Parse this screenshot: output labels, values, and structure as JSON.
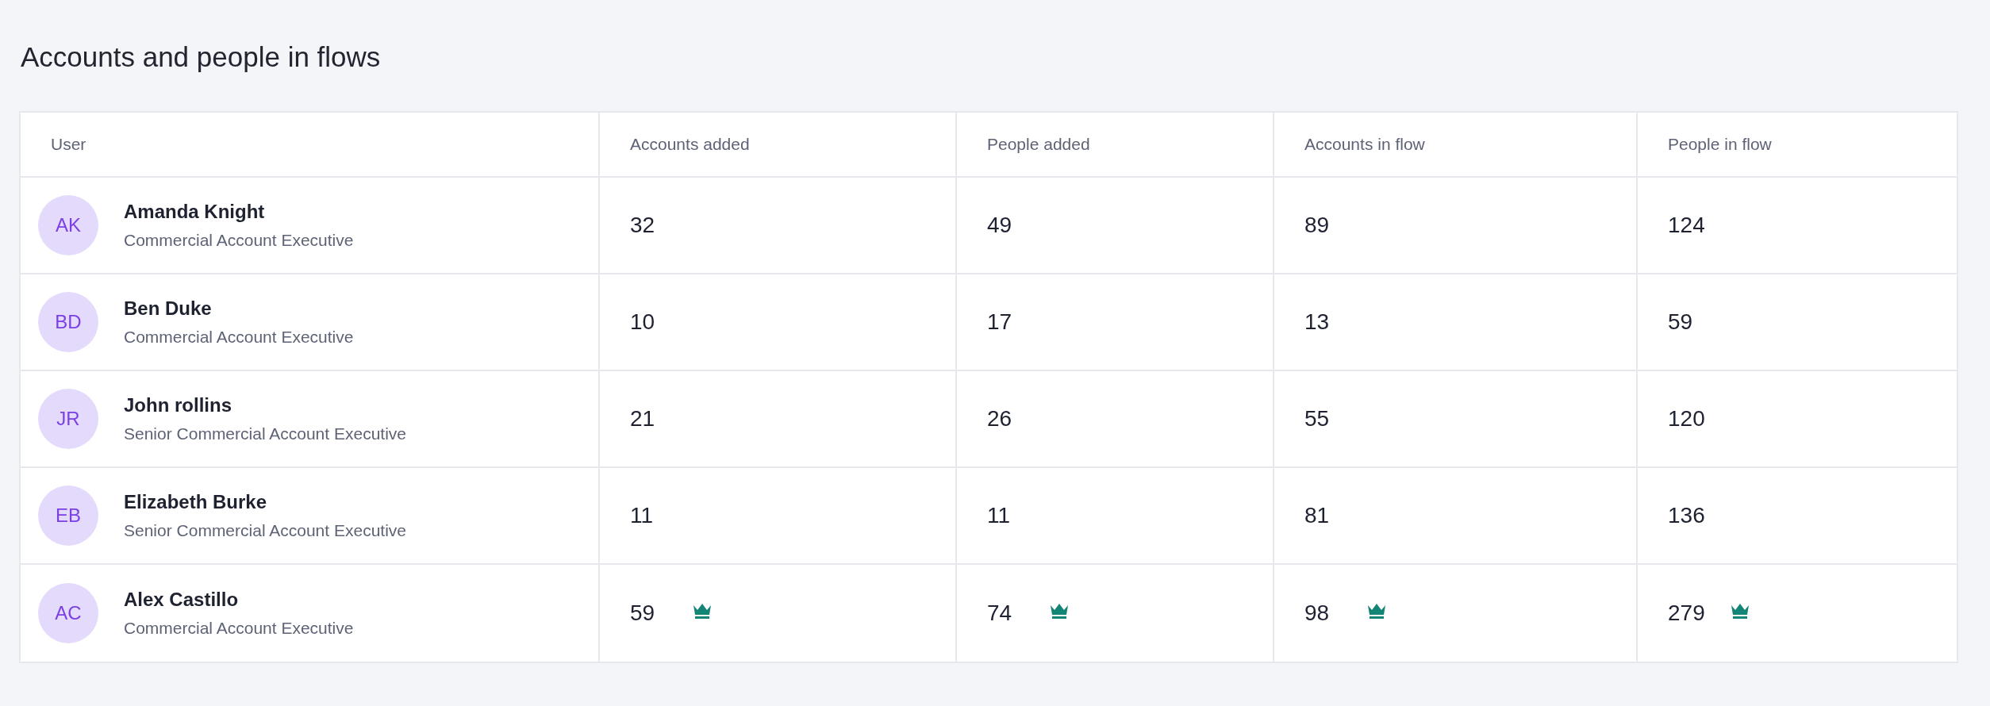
{
  "title": "Accounts and people in flows",
  "table": {
    "columns": [
      "User",
      "Accounts added",
      "People added",
      "Accounts in flow",
      "People in flow"
    ],
    "rows": [
      {
        "cells": [
          {
            "kind": "user",
            "initials": "AK",
            "name": "Amanda Knight",
            "role": "Commercial Account Executive"
          },
          {
            "kind": "metric",
            "value": "32",
            "top": false
          },
          {
            "kind": "metric",
            "value": "49",
            "top": false
          },
          {
            "kind": "metric",
            "value": "89",
            "top": false
          },
          {
            "kind": "metric",
            "value": "124",
            "top": false
          }
        ]
      },
      {
        "cells": [
          {
            "kind": "user",
            "initials": "BD",
            "name": "Ben Duke",
            "role": "Commercial Account Executive"
          },
          {
            "kind": "metric",
            "value": "10",
            "top": false
          },
          {
            "kind": "metric",
            "value": "17",
            "top": false
          },
          {
            "kind": "metric",
            "value": "13",
            "top": false
          },
          {
            "kind": "metric",
            "value": "59",
            "top": false
          }
        ]
      },
      {
        "cells": [
          {
            "kind": "user",
            "initials": "JR",
            "name": "John rollins",
            "role": "Senior Commercial Account Executive"
          },
          {
            "kind": "metric",
            "value": "21",
            "top": false
          },
          {
            "kind": "metric",
            "value": "26",
            "top": false
          },
          {
            "kind": "metric",
            "value": "55",
            "top": false
          },
          {
            "kind": "metric",
            "value": "120",
            "top": false
          }
        ]
      },
      {
        "cells": [
          {
            "kind": "user",
            "initials": "EB",
            "name": "Elizabeth Burke",
            "role": "Senior Commercial Account Executive"
          },
          {
            "kind": "metric",
            "value": "11",
            "top": false
          },
          {
            "kind": "metric",
            "value": "11",
            "top": false
          },
          {
            "kind": "metric",
            "value": "81",
            "top": false
          },
          {
            "kind": "metric",
            "value": "136",
            "top": false
          }
        ]
      },
      {
        "cells": [
          {
            "kind": "user",
            "initials": "AC",
            "name": "Alex Castillo",
            "role": "Commercial Account Executive"
          },
          {
            "kind": "metric",
            "value": "59",
            "top": true
          },
          {
            "kind": "metric",
            "value": "74",
            "top": true
          },
          {
            "kind": "metric",
            "value": "98",
            "top": true
          },
          {
            "kind": "metric",
            "value": "279",
            "top": true
          }
        ]
      }
    ]
  }
}
